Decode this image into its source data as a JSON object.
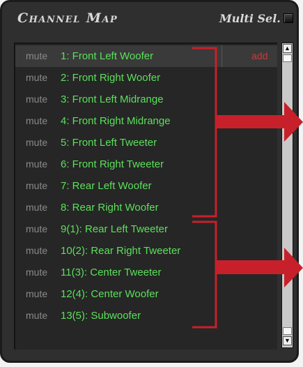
{
  "header": {
    "title": "Channel Map",
    "multi_select_label": "Multi Sel."
  },
  "channels": [
    {
      "mute": "mute",
      "label": "1: Front Left Woofer",
      "add": "add"
    },
    {
      "mute": "mute",
      "label": "2: Front Right Woofer"
    },
    {
      "mute": "mute",
      "label": "3: Front Left Midrange"
    },
    {
      "mute": "mute",
      "label": "4: Front Right Midrange"
    },
    {
      "mute": "mute",
      "label": "5: Front Left Tweeter"
    },
    {
      "mute": "mute",
      "label": "6: Front Right Tweeter"
    },
    {
      "mute": "mute",
      "label": "7: Rear Left Woofer"
    },
    {
      "mute": "mute",
      "label": "8: Rear Right Woofer"
    },
    {
      "mute": "mute",
      "label": "9(1): Rear Left Tweeter"
    },
    {
      "mute": "mute",
      "label": "10(2): Rear Right Tweeter"
    },
    {
      "mute": "mute",
      "label": "11(3): Center Tweeter"
    },
    {
      "mute": "mute",
      "label": "12(4): Center Woofer"
    },
    {
      "mute": "mute",
      "label": "13(5): Subwoofer"
    }
  ],
  "colors": {
    "channel_label": "#5be05b",
    "add_label": "#c83a3a",
    "annotation": "#c8202a"
  },
  "icons": {
    "scroll_up": "scroll-up-arrow-icon",
    "scroll_down": "scroll-down-arrow-icon"
  }
}
